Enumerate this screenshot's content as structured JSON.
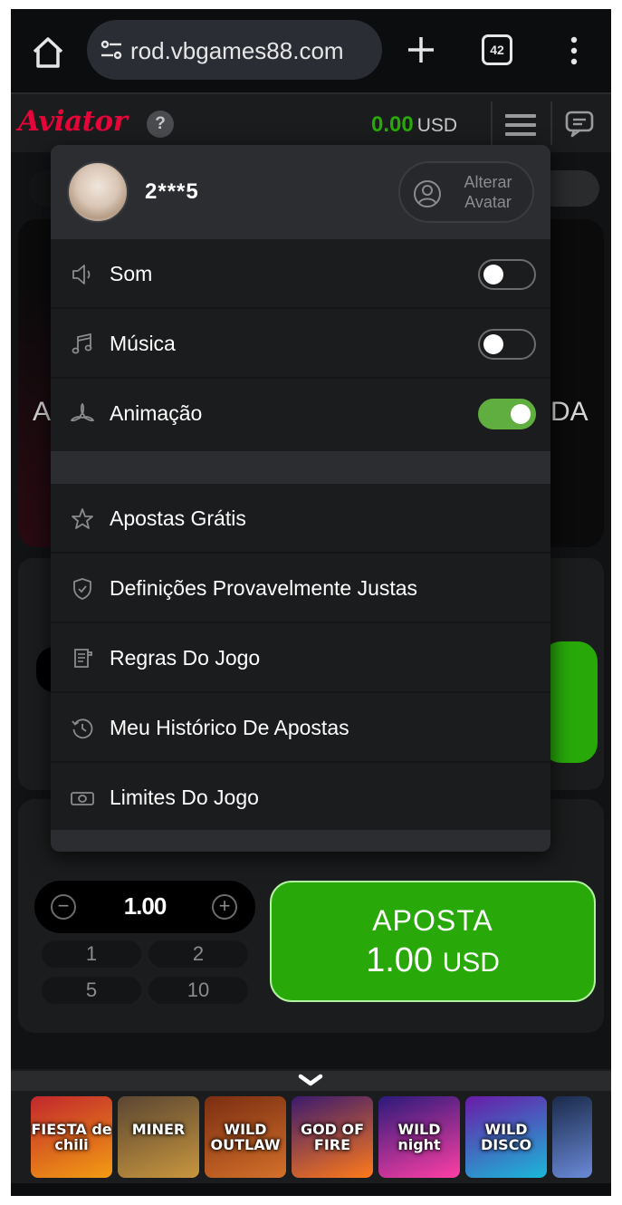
{
  "browser": {
    "url": "rod.vbgames88.com",
    "tab_count": "42"
  },
  "header": {
    "logo": "Aviator",
    "help": "?",
    "balance_amount": "0.00",
    "balance_currency": "USD"
  },
  "background": {
    "partial_left": "A",
    "partial_right": "DA"
  },
  "menu": {
    "username": "2***5",
    "change_avatar_label": "Alterar Avatar",
    "settings": [
      {
        "label": "Som",
        "on": false
      },
      {
        "label": "Música",
        "on": false
      },
      {
        "label": "Animação",
        "on": true
      }
    ],
    "links": [
      {
        "label": "Apostas Grátis"
      },
      {
        "label": "Definições Provavelmente Justas"
      },
      {
        "label": "Regras Do Jogo"
      },
      {
        "label": "Meu Histórico De Apostas"
      },
      {
        "label": "Limites Do Jogo"
      }
    ]
  },
  "bet": {
    "minus": "−",
    "plus": "+",
    "stake": "1.00",
    "quick_amounts": [
      "1",
      "2",
      "5",
      "10"
    ],
    "button_label": "APOSTA",
    "button_amount": "1.00",
    "button_currency": "USD"
  },
  "colors": {
    "accent_green": "#28a909",
    "toggle_on": "#60ae3f",
    "logo_red": "#e50539"
  },
  "games": [
    {
      "name": "FIESTA de chili",
      "colors": [
        "#c1272d",
        "#f39c12"
      ]
    },
    {
      "name": "MINER",
      "colors": [
        "#5a4632",
        "#c8963e"
      ]
    },
    {
      "name": "WILD OUTLAW",
      "colors": [
        "#7a2e12",
        "#d4702a"
      ]
    },
    {
      "name": "GOD OF FIRE",
      "colors": [
        "#3b1a6e",
        "#ff7a1a"
      ]
    },
    {
      "name": "WILD night",
      "colors": [
        "#2a1a7a",
        "#ff3fa4"
      ]
    },
    {
      "name": "WILD DISCO",
      "colors": [
        "#6a1aa8",
        "#1ab8d8"
      ]
    },
    {
      "name": "",
      "colors": [
        "#1a2a4a",
        "#6a8ad8"
      ]
    }
  ]
}
